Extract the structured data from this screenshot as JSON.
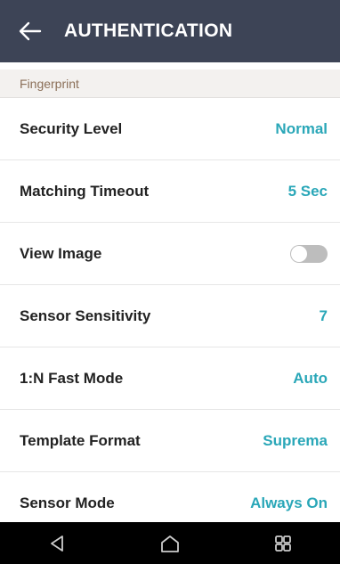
{
  "header": {
    "title": "AUTHENTICATION",
    "back_icon": "back-arrow-icon"
  },
  "section": {
    "label": "Fingerprint"
  },
  "settings": [
    {
      "label": "Security Level",
      "value": "Normal"
    },
    {
      "label": "Matching Timeout",
      "value": "5 Sec"
    },
    {
      "label": "View Image",
      "toggle_on": false
    },
    {
      "label": "Sensor Sensitivity",
      "value": "7"
    },
    {
      "label": "1:N Fast Mode",
      "value": "Auto"
    },
    {
      "label": "Template Format",
      "value": "Suprema"
    },
    {
      "label": "Sensor Mode",
      "value": "Always On"
    }
  ],
  "nav": {
    "back_icon": "nav-back-icon",
    "home_icon": "nav-home-icon",
    "recents_icon": "nav-recents-icon"
  },
  "colors": {
    "header_bg": "#3d4456",
    "accent": "#2aa7b8",
    "section_text": "#8b6f58",
    "section_bg": "#f3f1ef"
  }
}
